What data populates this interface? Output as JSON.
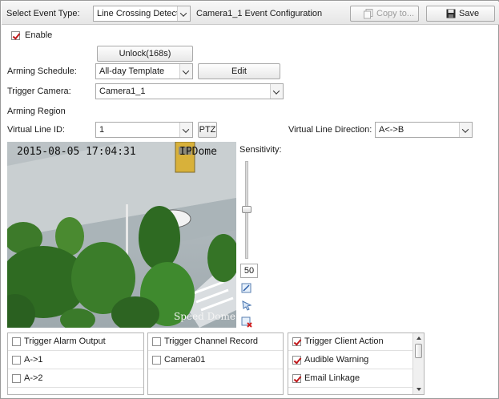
{
  "header": {
    "event_type_label": "Select Event Type:",
    "event_type_value": "Line Crossing Detect...",
    "config_title": "Camera1_1 Event Configuration",
    "copy_label": "Copy to...",
    "save_label": "Save"
  },
  "enable": {
    "label": "Enable",
    "checked": true
  },
  "unlock_label": "Unlock(168s)",
  "arming_schedule": {
    "label": "Arming Schedule:",
    "value": "All-day Template",
    "edit_label": "Edit"
  },
  "trigger_camera": {
    "label": "Trigger Camera:",
    "value": "Camera1_1"
  },
  "arming_region_label": "Arming Region",
  "virtual_line": {
    "id_label": "Virtual Line ID:",
    "id_value": "1",
    "ptz_label": "PTZ",
    "direction_label": "Virtual Line Direction:",
    "direction_value": "A<->B"
  },
  "video": {
    "timestamp": "2015-08-05 17:04:31",
    "top_text": "IPDome",
    "bottom_text": "Speed Dome"
  },
  "sensitivity": {
    "label": "Sensitivity:",
    "value": "50"
  },
  "panels": {
    "alarm_output": {
      "header": "Trigger Alarm Output",
      "items": [
        "A->1",
        "A->2"
      ]
    },
    "channel_record": {
      "header": "Trigger Channel Record",
      "items": [
        "Camera01"
      ]
    },
    "client_action": {
      "header": "Trigger Client Action",
      "items": [
        "Audible Warning",
        "Email Linkage"
      ]
    }
  },
  "colors": {
    "accent_check": "#c0191c",
    "topbar": "#e9e9e9",
    "border": "#a9a9a9"
  },
  "icons": [
    "copy-icon",
    "save-icon",
    "draw-line-icon",
    "select-pointer-icon",
    "delete-line-icon"
  ]
}
